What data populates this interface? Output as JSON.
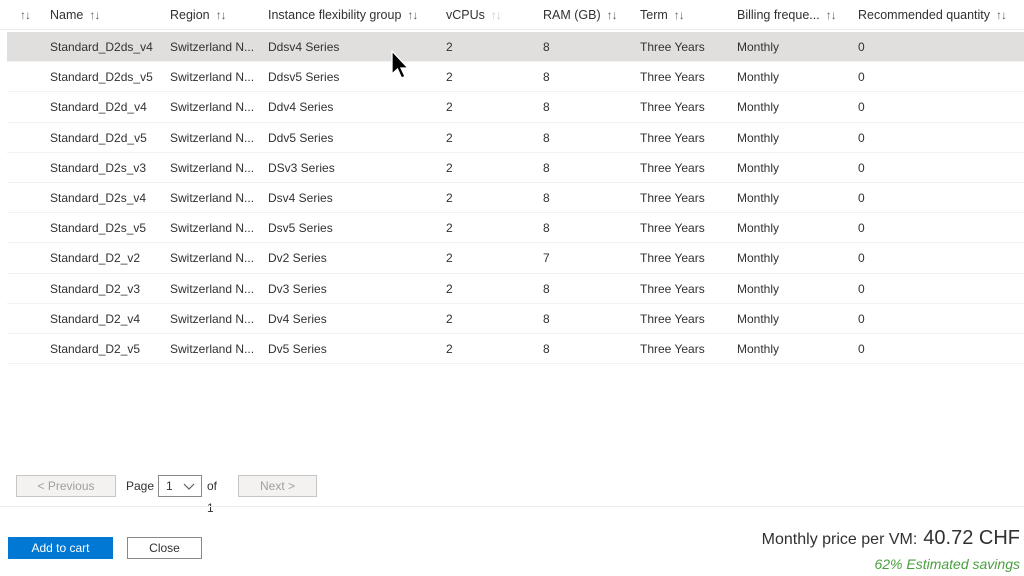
{
  "columns": {
    "name": "Name",
    "region": "Region",
    "flex": "Instance flexibility group",
    "vcpus": "vCPUs",
    "ram": "RAM (GB)",
    "term": "Term",
    "billing": "Billing freque...",
    "qty": "Recommended quantity"
  },
  "sort_glyph": "↑↓",
  "rows": [
    {
      "name": "Standard_D2ds_v4",
      "region": "Switzerland N...",
      "flex": "Ddsv4 Series",
      "vcpus": "2",
      "ram": "8",
      "term": "Three Years",
      "billing": "Monthly",
      "qty": "0",
      "selected": true
    },
    {
      "name": "Standard_D2ds_v5",
      "region": "Switzerland N...",
      "flex": "Ddsv5 Series",
      "vcpus": "2",
      "ram": "8",
      "term": "Three Years",
      "billing": "Monthly",
      "qty": "0"
    },
    {
      "name": "Standard_D2d_v4",
      "region": "Switzerland N...",
      "flex": "Ddv4 Series",
      "vcpus": "2",
      "ram": "8",
      "term": "Three Years",
      "billing": "Monthly",
      "qty": "0"
    },
    {
      "name": "Standard_D2d_v5",
      "region": "Switzerland N...",
      "flex": "Ddv5 Series",
      "vcpus": "2",
      "ram": "8",
      "term": "Three Years",
      "billing": "Monthly",
      "qty": "0"
    },
    {
      "name": "Standard_D2s_v3",
      "region": "Switzerland N...",
      "flex": "DSv3 Series",
      "vcpus": "2",
      "ram": "8",
      "term": "Three Years",
      "billing": "Monthly",
      "qty": "0"
    },
    {
      "name": "Standard_D2s_v4",
      "region": "Switzerland N...",
      "flex": "Dsv4 Series",
      "vcpus": "2",
      "ram": "8",
      "term": "Three Years",
      "billing": "Monthly",
      "qty": "0"
    },
    {
      "name": "Standard_D2s_v5",
      "region": "Switzerland N...",
      "flex": "Dsv5 Series",
      "vcpus": "2",
      "ram": "8",
      "term": "Three Years",
      "billing": "Monthly",
      "qty": "0"
    },
    {
      "name": "Standard_D2_v2",
      "region": "Switzerland N...",
      "flex": "Dv2 Series",
      "vcpus": "2",
      "ram": "7",
      "term": "Three Years",
      "billing": "Monthly",
      "qty": "0"
    },
    {
      "name": "Standard_D2_v3",
      "region": "Switzerland N...",
      "flex": "Dv3 Series",
      "vcpus": "2",
      "ram": "8",
      "term": "Three Years",
      "billing": "Monthly",
      "qty": "0"
    },
    {
      "name": "Standard_D2_v4",
      "region": "Switzerland N...",
      "flex": "Dv4 Series",
      "vcpus": "2",
      "ram": "8",
      "term": "Three Years",
      "billing": "Monthly",
      "qty": "0"
    },
    {
      "name": "Standard_D2_v5",
      "region": "Switzerland N...",
      "flex": "Dv5 Series",
      "vcpus": "2",
      "ram": "8",
      "term": "Three Years",
      "billing": "Monthly",
      "qty": "0"
    }
  ],
  "pager": {
    "previous": "< Previous",
    "page_label": "Page",
    "page_value": "1",
    "of_label": "of 1",
    "next": "Next >"
  },
  "actions": {
    "add_to_cart": "Add to cart",
    "close": "Close"
  },
  "summary": {
    "price_label": "Monthly price per VM:",
    "price_value": "40.72 CHF",
    "savings": "62% Estimated savings"
  },
  "colors": {
    "primary": "#0078d4",
    "selected_row": "#e1dfdd",
    "savings": "#4a9e3f"
  },
  "icons": {
    "sort": "sort-arrows-icon",
    "dropdown": "chevron-down-icon",
    "cursor": "mouse-pointer-icon"
  }
}
